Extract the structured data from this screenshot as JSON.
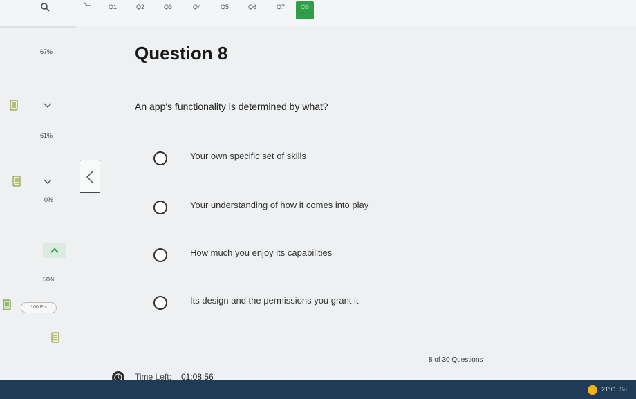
{
  "question_nav": {
    "tabs": [
      {
        "label": "Q1",
        "active": false
      },
      {
        "label": "Q2",
        "active": false
      },
      {
        "label": "Q3",
        "active": false
      },
      {
        "label": "Q4",
        "active": false
      },
      {
        "label": "Q5",
        "active": false
      },
      {
        "label": "Q6",
        "active": false
      },
      {
        "label": "Q7",
        "active": false
      },
      {
        "label": "Q8",
        "active": true
      }
    ],
    "active_color": "#2e9e48"
  },
  "sidebar": {
    "percentages": [
      "67%",
      "61%",
      "0%",
      "50%"
    ],
    "points_badge": "100 Pts"
  },
  "question": {
    "title": "Question 8",
    "text": "An app's functionality is determined by what?",
    "options": [
      "Your own specific set of skills",
      "Your understanding of how it comes into play",
      "How much you enjoy its capabilities",
      "Its design and the permissions you grant it"
    ]
  },
  "footer": {
    "progress": "8 of 30 Questions",
    "timer_label": "Time Left:",
    "timer_value": "01:08:56"
  },
  "taskbar": {
    "temperature": "21°C",
    "weather_text": "Su"
  }
}
